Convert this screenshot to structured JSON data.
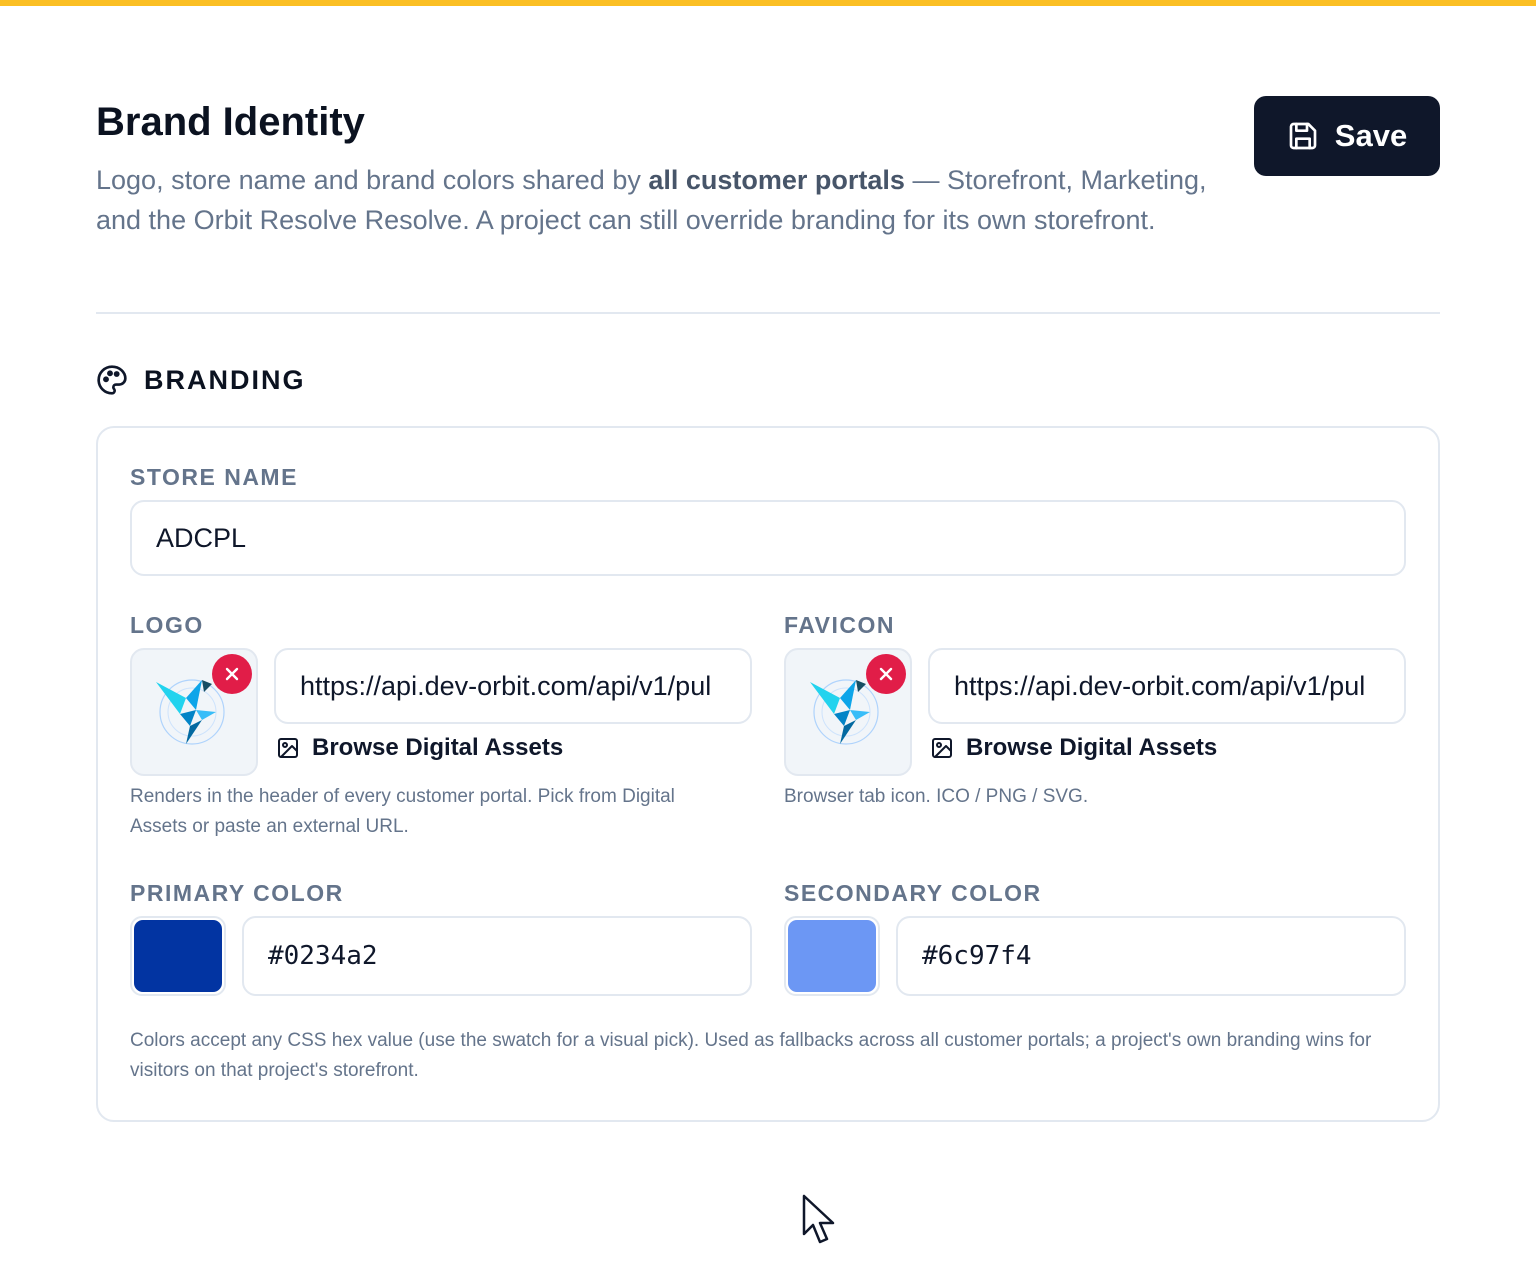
{
  "header": {
    "title": "Brand Identity",
    "desc_part1": "Logo, store name and brand colors shared by ",
    "desc_bold": "all customer portals",
    "desc_part2": " — Storefront, Marketing, and the Orbit Resolve Resolve. A project can still override branding for its own storefront.",
    "save_label": "Save",
    "save_icon": "save-icon"
  },
  "section": {
    "title": "BRANDING",
    "icon": "palette-icon"
  },
  "store_name": {
    "label": "STORE NAME",
    "value": "ADCPL"
  },
  "logo": {
    "label": "LOGO",
    "url": "https://api.dev-orbit.com/api/v1/pul",
    "browse_label": "Browse Digital Assets",
    "help": "Renders in the header of every customer portal. Pick from Digital Assets or paste an external URL."
  },
  "favicon": {
    "label": "FAVICON",
    "url": "https://api.dev-orbit.com/api/v1/pul",
    "browse_label": "Browse Digital Assets",
    "help": "Browser tab icon. ICO / PNG / SVG."
  },
  "primary_color": {
    "label": "PRIMARY COLOR",
    "value": "#0234a2"
  },
  "secondary_color": {
    "label": "SECONDARY COLOR",
    "value": "#6c97f4"
  },
  "colors_help": "Colors accept any CSS hex value (use the swatch for a visual pick). Used as fallbacks across all customer portals; a project's own branding wins for visitors on that project's storefront.",
  "theme": {
    "accent_bar": "#fbbf24",
    "button_bg": "#0f172a",
    "remove_red": "#e11d48"
  }
}
